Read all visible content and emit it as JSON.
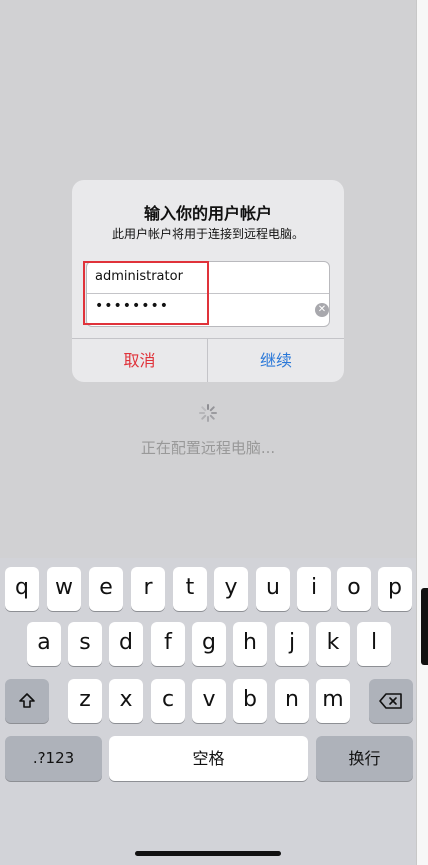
{
  "dialog": {
    "title": "输入你的用户帐户",
    "subtitle": "此用户帐户将用于连接到远程电脑。",
    "username_value": "administrator",
    "password_dots": "••••••••",
    "cancel_label": "取消",
    "continue_label": "继续"
  },
  "status": {
    "text": "正在配置远程电脑..."
  },
  "keyboard": {
    "row1": [
      "q",
      "w",
      "e",
      "r",
      "t",
      "y",
      "u",
      "i",
      "o",
      "p"
    ],
    "row2": [
      "a",
      "s",
      "d",
      "f",
      "g",
      "h",
      "j",
      "k",
      "l"
    ],
    "row3": [
      "z",
      "x",
      "c",
      "v",
      "b",
      "n",
      "m"
    ],
    "numbers_label": ".?123",
    "space_label": "空格",
    "return_label": "换行",
    "icons": {
      "shift": "shift-icon",
      "delete": "backspace-icon",
      "clear": "clear-icon",
      "loading": "spinner-icon"
    }
  },
  "colors": {
    "cancel": "#e0323a",
    "continue": "#2a78d8",
    "highlight": "#e0323a"
  }
}
